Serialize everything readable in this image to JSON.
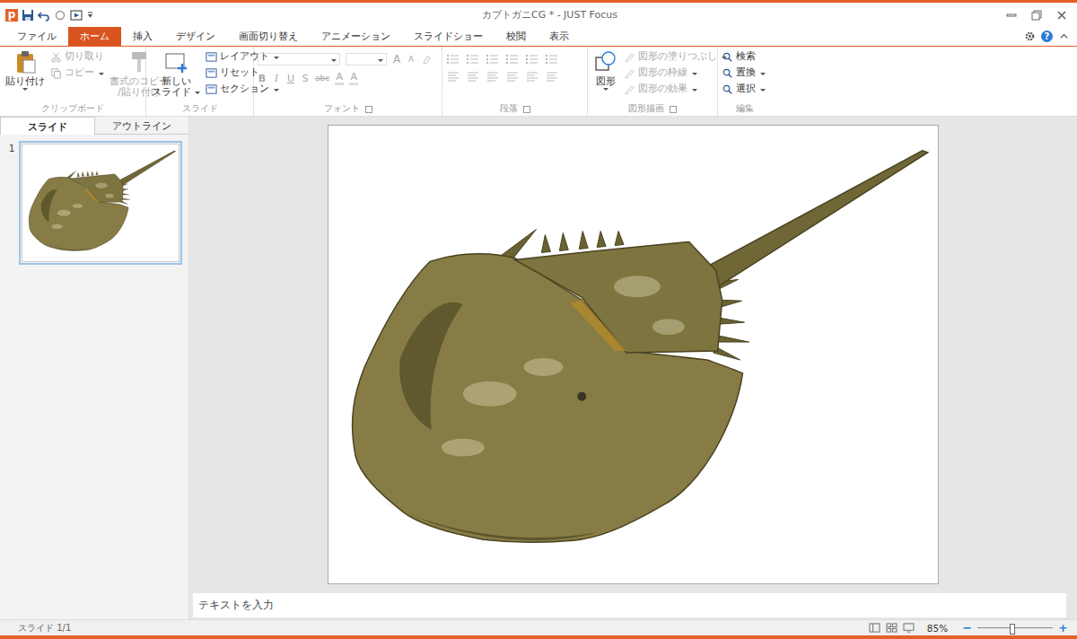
{
  "window": {
    "logo": "p",
    "title": "カブトガニCG * - JUST Focus"
  },
  "menu_tabs": [
    {
      "label": "ファイル",
      "selected": false
    },
    {
      "label": "ホーム",
      "selected": true
    },
    {
      "label": "挿入",
      "selected": false
    },
    {
      "label": "デザイン",
      "selected": false
    },
    {
      "label": "画面切り替え",
      "selected": false
    },
    {
      "label": "アニメーション",
      "selected": false
    },
    {
      "label": "スライドショー",
      "selected": false
    },
    {
      "label": "校閲",
      "selected": false
    },
    {
      "label": "表示",
      "selected": false
    }
  ],
  "help": "?",
  "ribbon": {
    "clipboard": {
      "label": "クリップボード",
      "paste": {
        "label": "貼り付け",
        "disabled": false,
        "dropdown": true
      },
      "cut": {
        "label": "切り取り",
        "disabled": true,
        "dropdown": false
      },
      "copy": {
        "label": "コピー",
        "disabled": true,
        "dropdown": true
      },
      "format_painter": {
        "lines": [
          "書式のコピー",
          "/貼り付け"
        ],
        "disabled": true
      }
    },
    "slides": {
      "label": "スライド",
      "new_slide": {
        "lines": [
          "新しい",
          "スライド"
        ],
        "dropdown": true
      },
      "items": [
        {
          "label": "レイアウト",
          "dropdown": true
        },
        {
          "label": "リセット",
          "dropdown": false
        },
        {
          "label": "セクション",
          "dropdown": true
        }
      ]
    },
    "font": {
      "label": "フォント",
      "disabled": true,
      "row1": [
        "A",
        "A"
      ],
      "row2": [
        "B",
        "I",
        "U",
        "S",
        "abc",
        "A",
        "A"
      ]
    },
    "paragraph": {
      "label": "段落",
      "disabled": true
    },
    "drawing": {
      "label": "図形描画",
      "shapes": {
        "label": "図形",
        "dropdown": true
      },
      "items": [
        {
          "label": "図形の塗りつぶし",
          "disabled": true,
          "dropdown": true
        },
        {
          "label": "図形の枠線",
          "disabled": true,
          "dropdown": true
        },
        {
          "label": "図形の効果",
          "disabled": true,
          "dropdown": true
        }
      ]
    },
    "editing": {
      "label": "編集",
      "items": [
        {
          "label": "検索",
          "dropdown": false
        },
        {
          "label": "置換",
          "dropdown": true
        },
        {
          "label": "選択",
          "dropdown": true
        }
      ]
    }
  },
  "side_panel": {
    "tabs": [
      {
        "label": "スライド",
        "selected": true
      },
      {
        "label": "アウトライン",
        "selected": false
      }
    ],
    "slides": [
      {
        "number": "1",
        "selected": true
      }
    ]
  },
  "notes": {
    "placeholder": "テキストを入力"
  },
  "status_bar": {
    "slide": "スライド 1/1",
    "zoom": "85%",
    "zoom_level": 0.45,
    "zoom_out": "−",
    "zoom_in": "+"
  }
}
